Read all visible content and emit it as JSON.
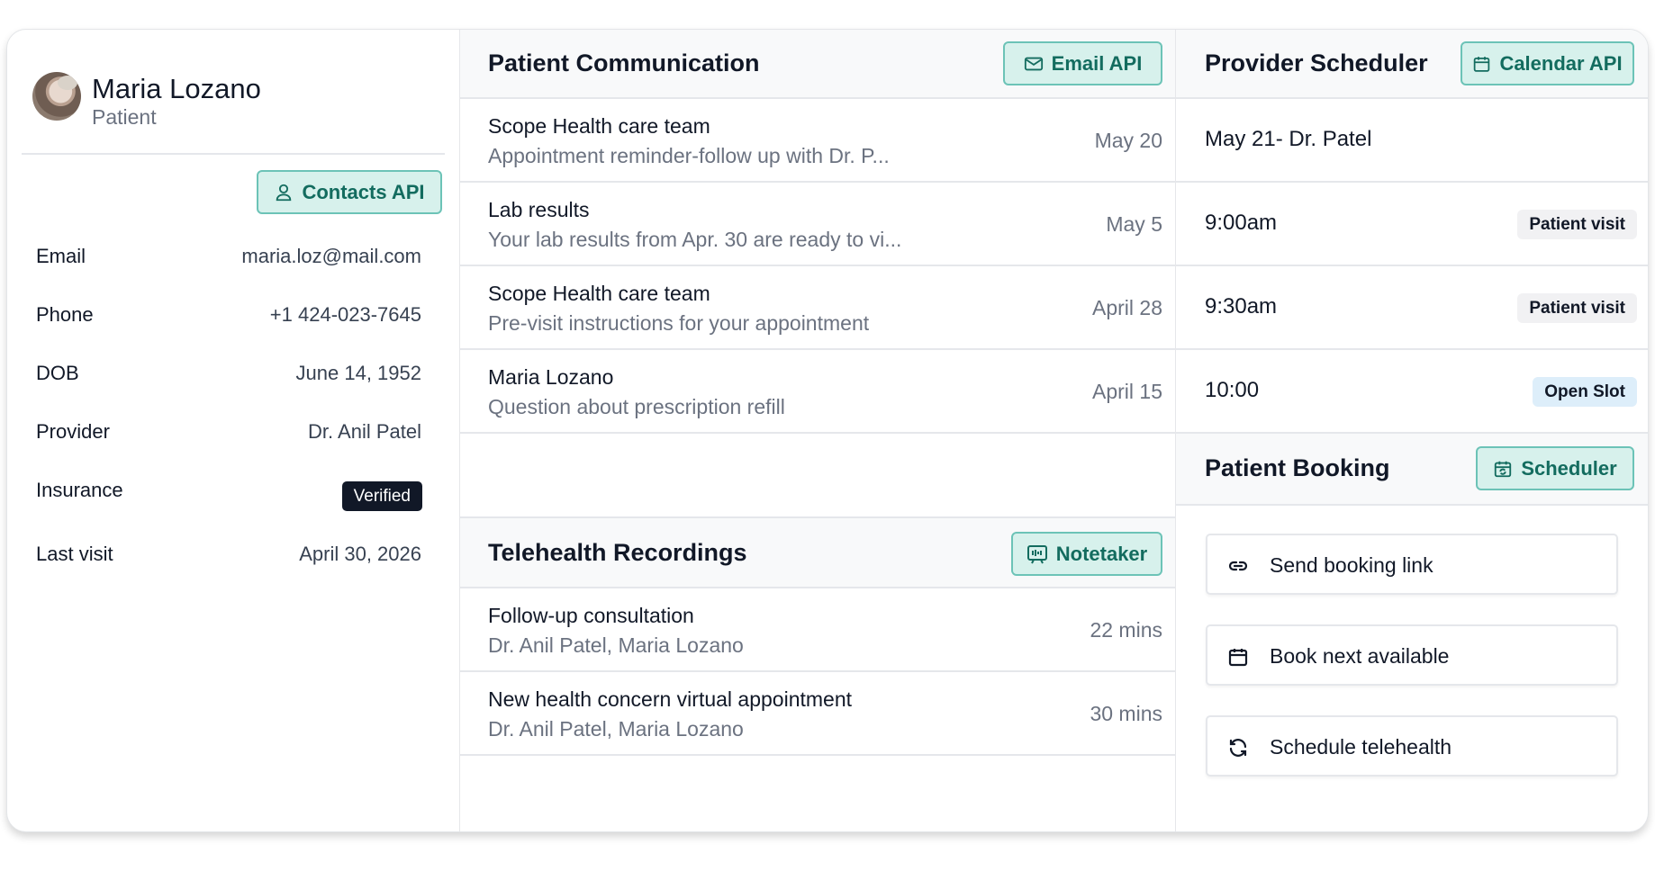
{
  "profile": {
    "name": "Maria Lozano",
    "role": "Patient",
    "contacts_button": "Contacts API",
    "fields": [
      {
        "label": "Email",
        "value": "maria.loz@mail.com"
      },
      {
        "label": "Phone",
        "value": "+1 424-023-7645"
      },
      {
        "label": "DOB",
        "value": "June 14, 1952"
      },
      {
        "label": "Provider",
        "value": "Dr. Anil Patel"
      },
      {
        "label": "Insurance",
        "value": "Verified"
      },
      {
        "label": "Last visit",
        "value": "April 30, 2026"
      }
    ]
  },
  "communication": {
    "title": "Patient Communication",
    "button": "Email API",
    "messages": [
      {
        "title": "Scope Health care team",
        "preview": "Appointment reminder-follow up with Dr. P...",
        "date": "May 20"
      },
      {
        "title": "Lab results",
        "preview": "Your lab results from Apr. 30 are ready to vi...",
        "date": "May 5"
      },
      {
        "title": "Scope Health care team",
        "preview": "Pre-visit instructions for your appointment",
        "date": "April 28"
      },
      {
        "title": "Maria Lozano",
        "preview": "Question about prescription refill",
        "date": "April 15"
      }
    ]
  },
  "recordings": {
    "title": "Telehealth Recordings",
    "button": "Notetaker",
    "items": [
      {
        "title": "Follow-up consultation",
        "participants": "Dr. Anil Patel, Maria Lozano",
        "duration": "22 mins"
      },
      {
        "title": "New health concern virtual appointment",
        "participants": "Dr. Anil Patel, Maria Lozano",
        "duration": "30 mins"
      }
    ]
  },
  "scheduler": {
    "title": "Provider Scheduler",
    "button": "Calendar API",
    "date_heading": "May 21- Dr. Patel",
    "slots": [
      {
        "time": "9:00am",
        "status": "Patient visit"
      },
      {
        "time": "9:30am",
        "status": "Patient visit"
      },
      {
        "time": "10:00",
        "status": "Open Slot"
      }
    ]
  },
  "booking": {
    "title": "Patient Booking",
    "button": "Scheduler",
    "actions": [
      {
        "label": "Send booking link",
        "icon": "link-icon"
      },
      {
        "label": "Book next available",
        "icon": "calendar-icon"
      },
      {
        "label": "Schedule telehealth",
        "icon": "refresh-icon"
      }
    ]
  },
  "colors": {
    "accent_fill": "#d7f1ec",
    "accent_border": "#6cc3b7",
    "accent_text": "#136c5f",
    "verified_badge": "#111827",
    "open_slot_badge": "#ddeefa"
  }
}
